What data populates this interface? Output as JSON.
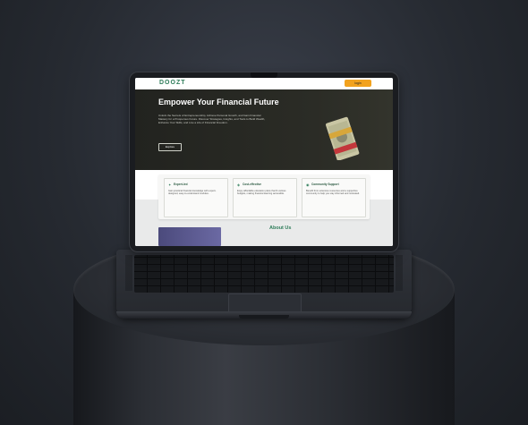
{
  "navbar": {
    "logo": "DOOZT",
    "login_label": "login"
  },
  "hero": {
    "title": "Empower Your Financial Future",
    "body": "Unlock the Secrets of Entrepreneurship, Achieve Personal Growth, and Gain Financial Mastery for a Prosperous Future. Discover Strategies, Insights, and Tools to Build Wealth, Enhance Your Skills, and Live a Life of Financial Freedom.",
    "cta_label": "Explore"
  },
  "features": [
    {
      "icon": "lightbulb-icon",
      "title": "Expert-led",
      "desc": "Gain practical financial knowledge with expert-designed, easy-to-understand modules."
    },
    {
      "icon": "savings-icon",
      "title": "Cost-effective",
      "desc": "Enjoy affordable education plans that fit various budgets, making financial learning accessible."
    },
    {
      "icon": "community-icon",
      "title": "Community Support",
      "desc": "Benefit from extensive resources and a supportive community to help you stay informed and motivated."
    }
  ],
  "about": {
    "title": "About Us"
  },
  "colors": {
    "brand_green": "#2f7d5a",
    "accent_orange": "#f2a21e",
    "hero_bg": "#22231f"
  }
}
